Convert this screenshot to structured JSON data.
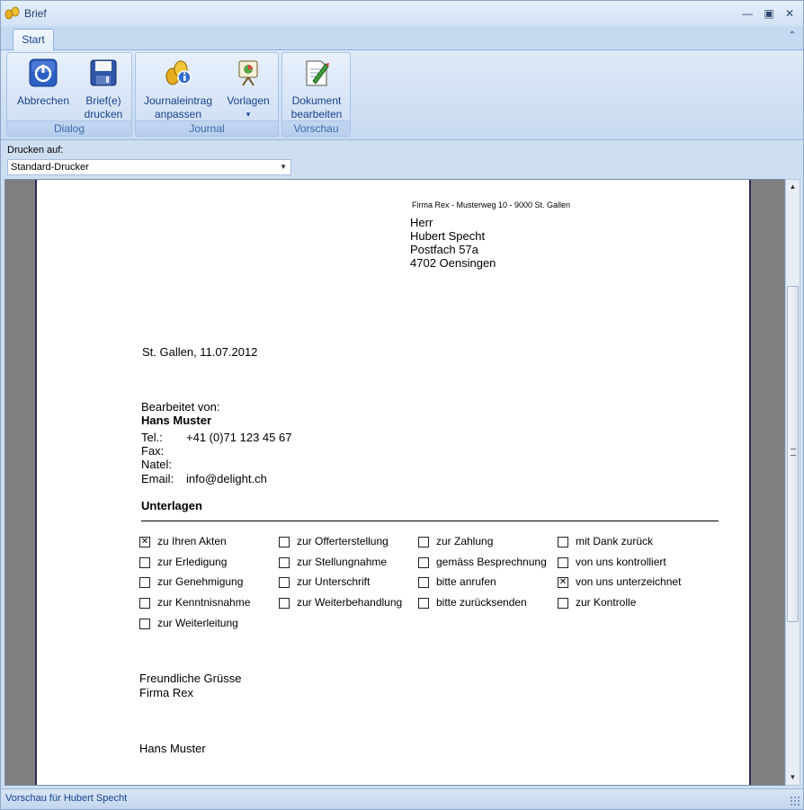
{
  "window": {
    "title": "Brief"
  },
  "ribbon": {
    "tab": "Start",
    "groups": [
      {
        "label": "Dialog",
        "buttons": [
          {
            "label_1": "Abbrechen",
            "label_2": "",
            "icon": "power-icon"
          },
          {
            "label_1": "Brief(e)",
            "label_2": "drucken",
            "icon": "save-disk-icon"
          }
        ]
      },
      {
        "label": "Journal",
        "buttons": [
          {
            "label_1": "Journaleintrag",
            "label_2": "anpassen",
            "icon": "journal-info-icon"
          },
          {
            "label_1": "Vorlagen",
            "label_2": "▾",
            "icon": "presentation-board-icon"
          }
        ]
      },
      {
        "label": "Vorschau",
        "buttons": [
          {
            "label_1": "Dokument",
            "label_2": "bearbeiten",
            "icon": "edit-document-icon"
          }
        ]
      }
    ]
  },
  "printer": {
    "label": "Drucken auf:",
    "selected": "Standard-Drucker"
  },
  "letter": {
    "sender_line": "Firma Rex - Musterweg 10 - 9000 St. Gallen",
    "recipient": [
      "Herr",
      "Hubert Specht",
      "Postfach 57a",
      "4702 Oensingen"
    ],
    "date_line": "St. Gallen, 11.07.2012",
    "edited_by_label": "Bearbeitet von:",
    "edited_by_name": "Hans Muster",
    "contact": [
      {
        "label": "Tel.:",
        "value": "+41 (0)71 123 45 67"
      },
      {
        "label": "Fax:",
        "value": ""
      },
      {
        "label": "Natel:",
        "value": ""
      },
      {
        "label": "Email:",
        "value": "info@delight.ch"
      }
    ],
    "section_title": "Unterlagen",
    "checkboxes": [
      {
        "label": "zu Ihren Akten",
        "checked": true
      },
      {
        "label": "zur Offerterstellung",
        "checked": false
      },
      {
        "label": "zur Zahlung",
        "checked": false
      },
      {
        "label": "mit Dank zurück",
        "checked": false
      },
      {
        "label": "zur Erledigung",
        "checked": false
      },
      {
        "label": "zur Stellungnahme",
        "checked": false
      },
      {
        "label": "gemäss Besprechnung",
        "checked": false
      },
      {
        "label": "von uns kontrolliert",
        "checked": false
      },
      {
        "label": "zur Genehmigung",
        "checked": false
      },
      {
        "label": "zur Unterschrift",
        "checked": false
      },
      {
        "label": "bitte anrufen",
        "checked": false
      },
      {
        "label": "von uns unterzeichnet",
        "checked": true
      },
      {
        "label": "zur Kenntnisnahme",
        "checked": false
      },
      {
        "label": "zur Weiterbehandlung",
        "checked": false
      },
      {
        "label": "bitte zurücksenden",
        "checked": false
      },
      {
        "label": "zur Kontrolle",
        "checked": false
      },
      {
        "label": "zur Weiterleitung",
        "checked": false
      }
    ],
    "closing": [
      "Freundliche Grüsse",
      "Firma Rex"
    ],
    "signature": "Hans Muster"
  },
  "status": {
    "text": "Vorschau für Hubert Specht"
  }
}
